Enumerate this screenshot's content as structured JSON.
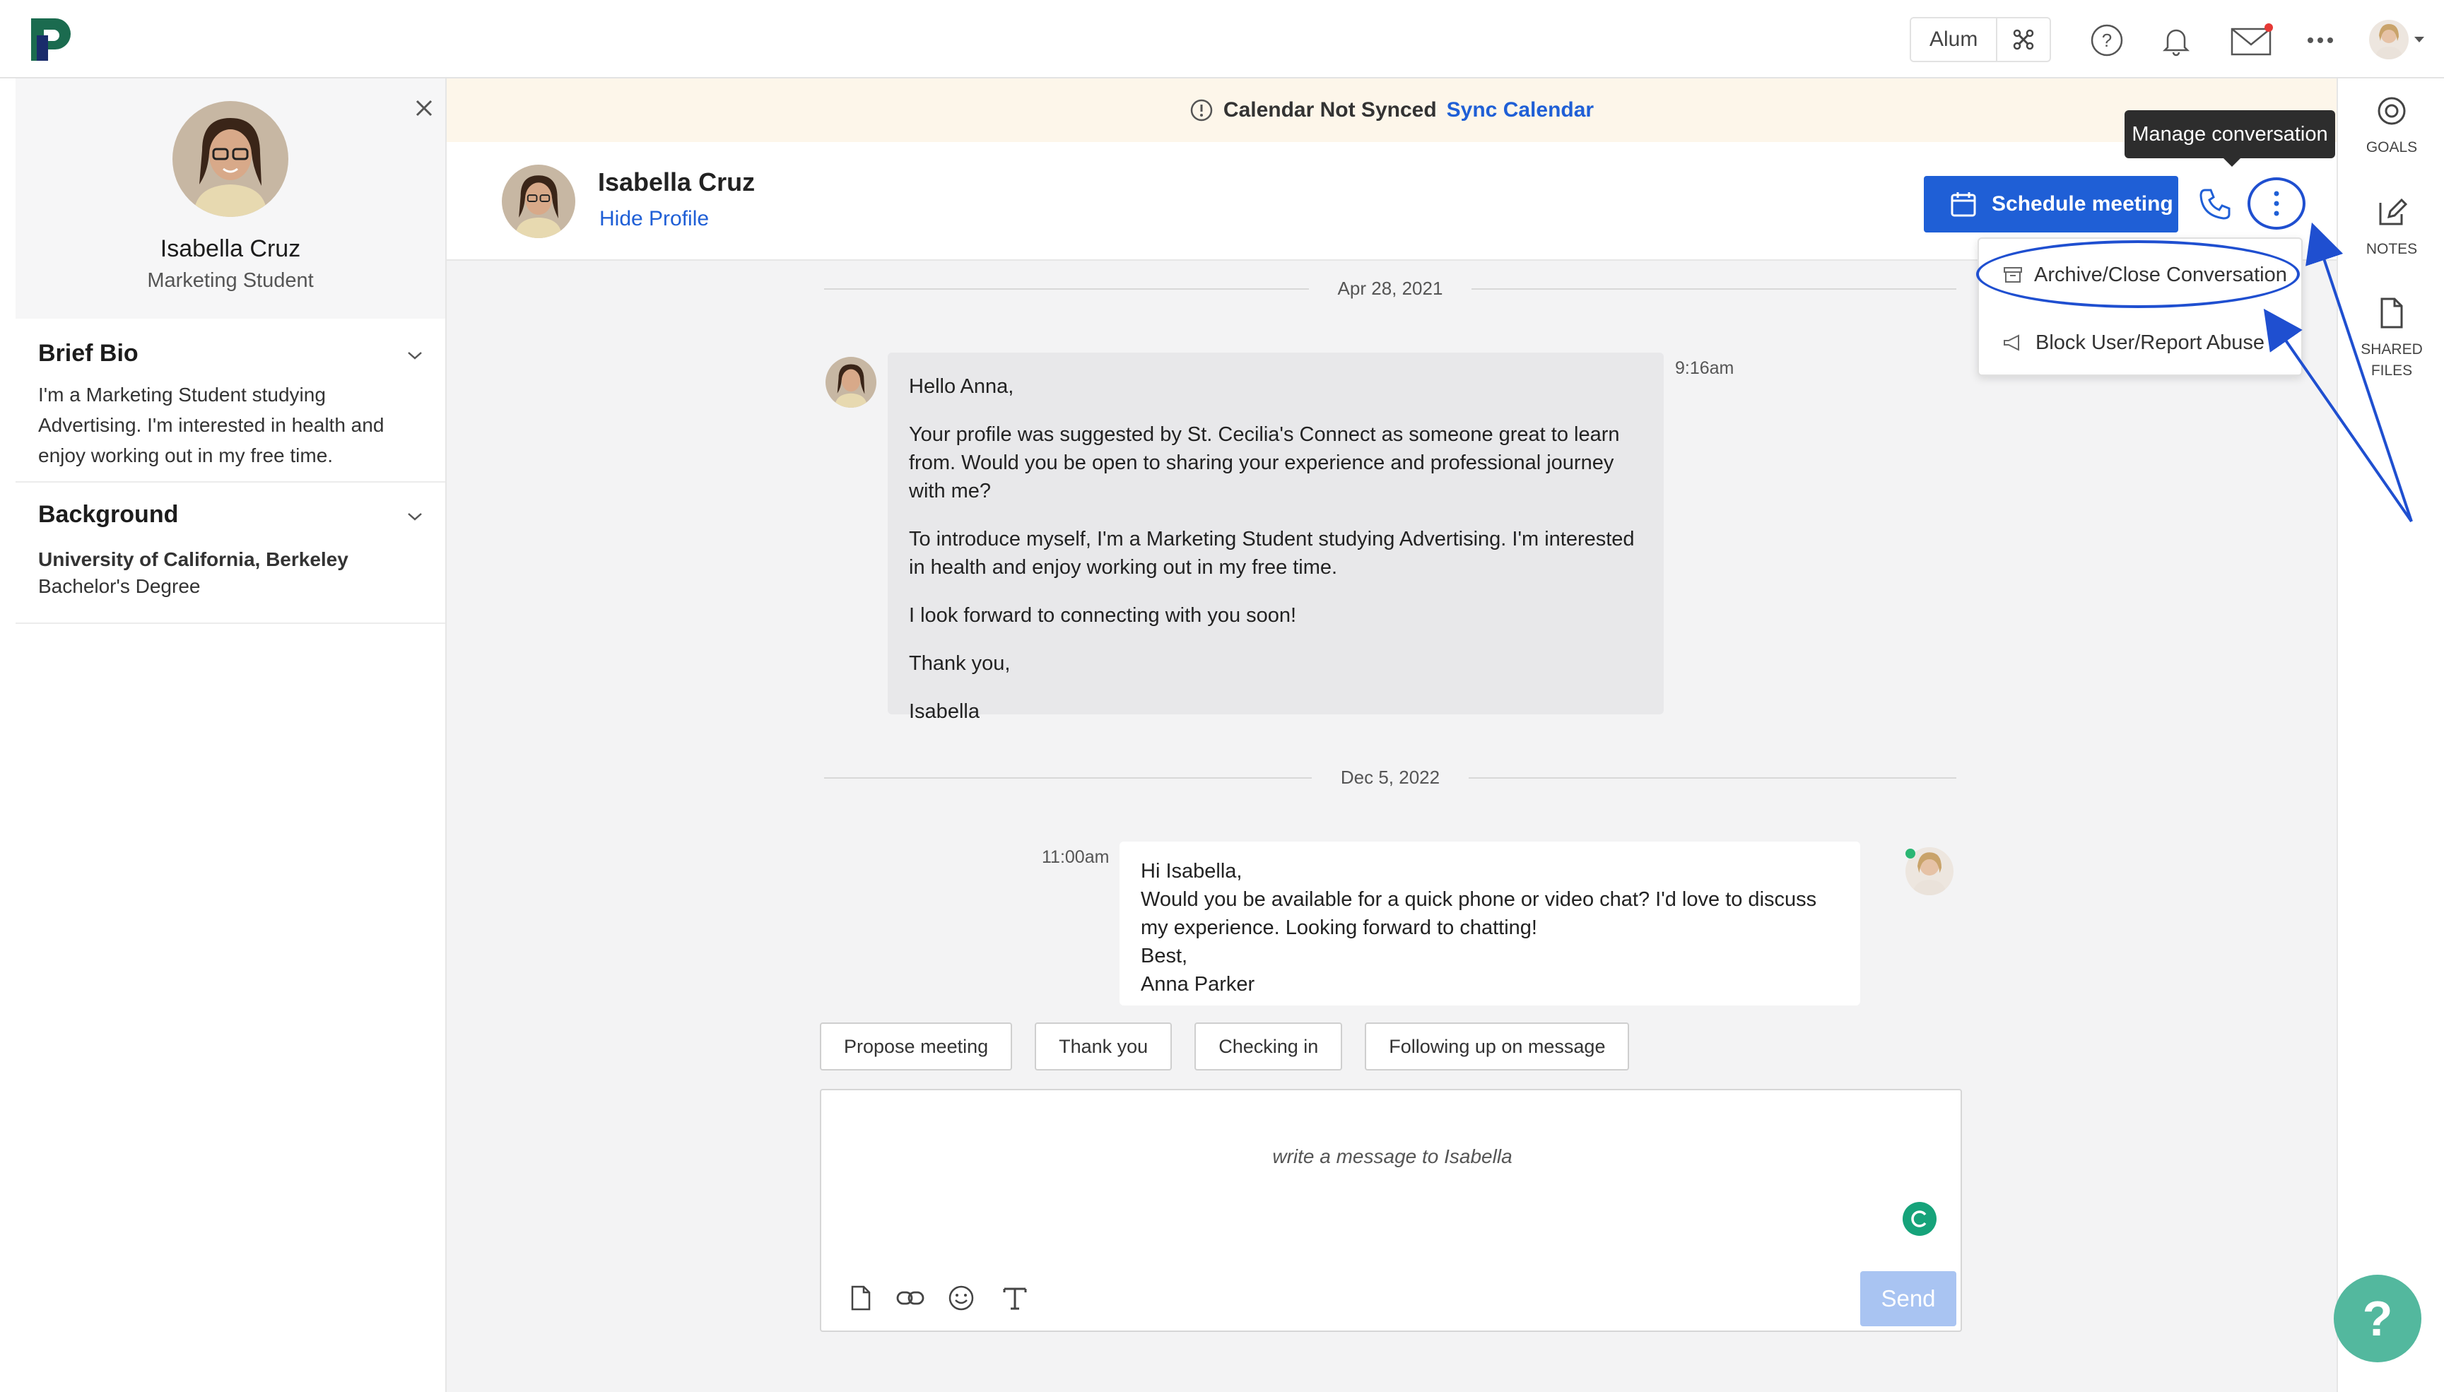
{
  "header": {
    "role_label": "Alum",
    "icons": [
      "logo-icon",
      "switch-role-icon",
      "help-circle-icon",
      "bell-icon",
      "mail-icon",
      "more-horizontal-icon",
      "user-avatar"
    ]
  },
  "profile": {
    "name": "Isabella Cruz",
    "subtitle": "Marketing Student",
    "brief_bio_title": "Brief Bio",
    "brief_bio_text": "I'm a Marketing Student studying Advertising. I'm interested in health and enjoy working out in my free time.",
    "background_title": "Background",
    "school": "University of California, Berkeley",
    "degree": "Bachelor's Degree"
  },
  "banner": {
    "text": "Calendar Not Synced",
    "link": "Sync Calendar"
  },
  "chat_header": {
    "name": "Isabella Cruz",
    "hide_profile": "Hide Profile",
    "schedule_label": "Schedule meeting"
  },
  "tooltip": "Manage conversation",
  "menu": {
    "archive": "Archive/Close Conversation",
    "block": "Block User/Report Abuse"
  },
  "messages": {
    "date1": "Apr 28, 2021",
    "m1_time": "9:16am",
    "m1_lines": [
      "Hello Anna,",
      "Your profile was suggested by St. Cecilia's Connect as someone great to learn from. Would you be open to sharing your experience and professional journey with me?",
      "To introduce myself, I'm a Marketing Student studying Advertising. I'm interested in health and enjoy working out in my free time.",
      "I look forward to connecting with you soon!",
      "Thank you,",
      "Isabella"
    ],
    "date2": "Dec 5, 2022",
    "m2_time": "11:00am",
    "m2_lines": [
      "Hi Isabella,",
      "Would you be available for a quick phone or video chat? I'd love to discuss my experience. Looking forward to chatting!",
      "Best,",
      "Anna Parker"
    ]
  },
  "quick_replies": [
    "Propose meeting",
    "Thank you",
    "Checking in",
    "Following up on message"
  ],
  "composer": {
    "placeholder": "write a message to Isabella",
    "send_label": "Send"
  },
  "right_rail": {
    "goals": "GOALS",
    "notes": "NOTES",
    "shared_files_1": "SHARED",
    "shared_files_2": "FILES"
  },
  "help_fab": "?",
  "colors": {
    "accent": "#1f5fd6",
    "annotation": "#1f4fd0",
    "banner_bg": "#fdf6ea",
    "help_fab": "#53b89e"
  }
}
